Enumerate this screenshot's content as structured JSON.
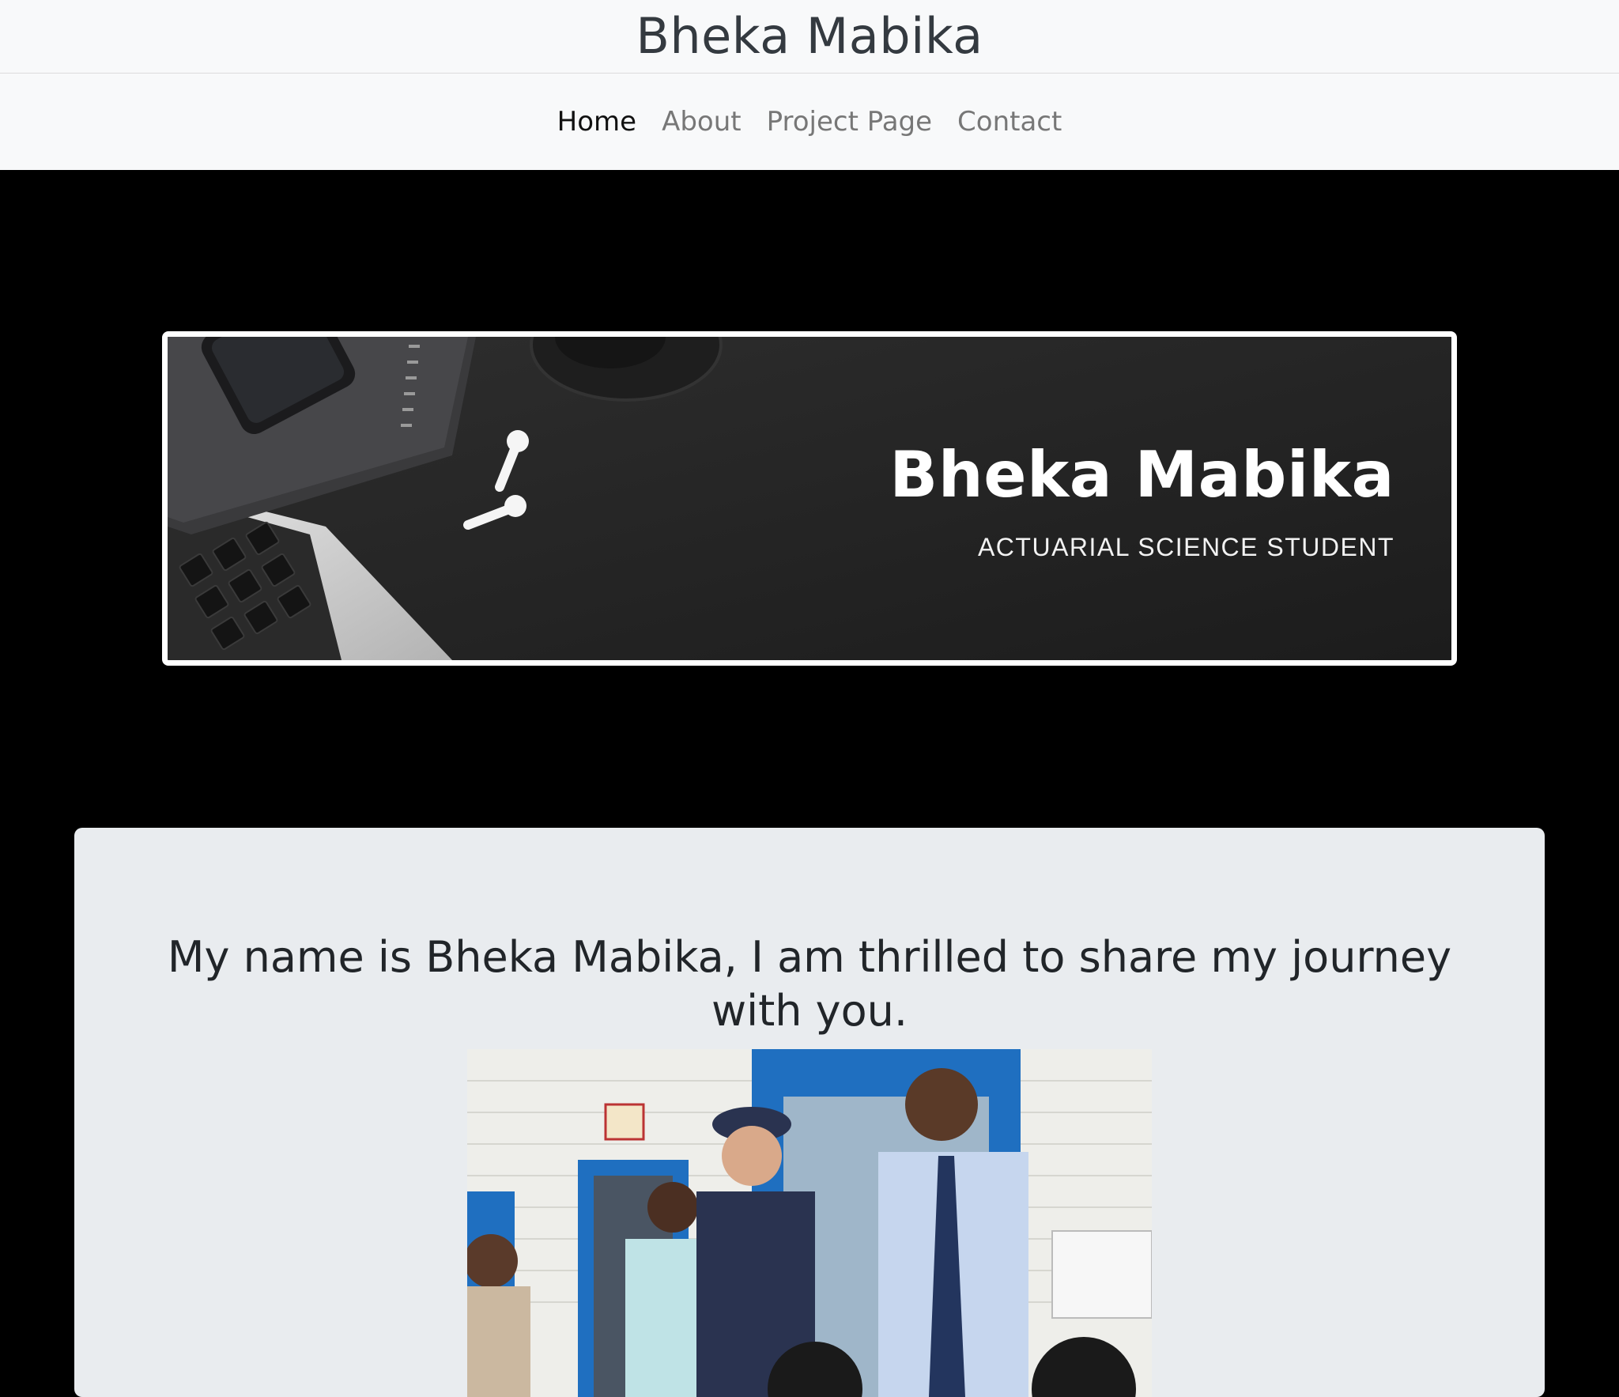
{
  "header": {
    "site_title": "Bheka Mabika"
  },
  "nav": {
    "items": [
      {
        "label": "Home",
        "active": true
      },
      {
        "label": "About",
        "active": false
      },
      {
        "label": "Project Page",
        "active": false
      },
      {
        "label": "Contact",
        "active": false
      }
    ]
  },
  "banner": {
    "title": "Bheka Mabika",
    "subtitle": "ACTUARIAL SCIENCE STUDENT"
  },
  "intro": {
    "heading": "My name is Bheka Mabika, I am thrilled to share my journey with you."
  },
  "colors": {
    "page_background": "#000000",
    "header_background": "#f8f9fa",
    "card_background": "#e9ecef",
    "accent_blue": "#1f6fc0"
  }
}
